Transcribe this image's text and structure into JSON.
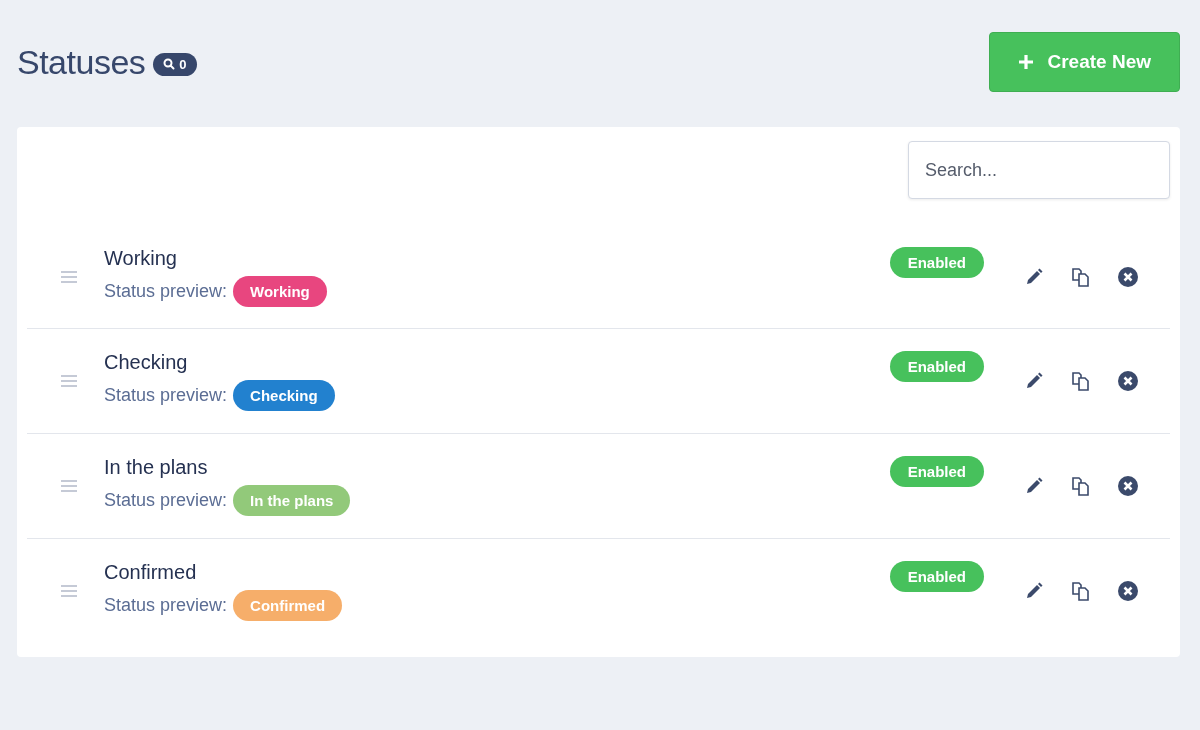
{
  "header": {
    "title": "Statuses",
    "count": "0",
    "create_button": "Create New"
  },
  "search": {
    "placeholder": "Search..."
  },
  "statuses": [
    {
      "name": "Working",
      "preview_label": "Status preview:",
      "preview": "Working",
      "color": "#e8467f",
      "state": "Enabled",
      "enabled": true
    },
    {
      "name": "Checking",
      "preview_label": "Status preview:",
      "preview": "Checking",
      "color": "#2281cf",
      "state": "Enabled",
      "enabled": true
    },
    {
      "name": "In the plans",
      "preview_label": "Status preview:",
      "preview": "In the plans",
      "color": "#92c97a",
      "state": "Enabled",
      "enabled": true
    },
    {
      "name": "Confirmed",
      "preview_label": "Status preview:",
      "preview": "Confirmed",
      "color": "#f6ae6a",
      "state": "Enabled",
      "enabled": true
    }
  ]
}
